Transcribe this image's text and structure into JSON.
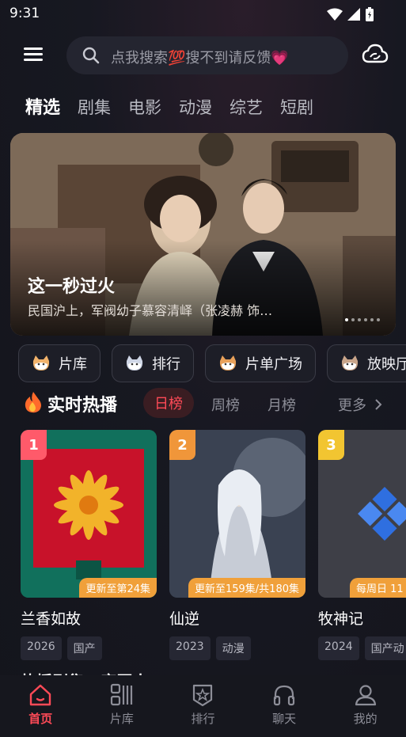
{
  "status_bar": {
    "time": "9:31"
  },
  "header": {
    "search_placeholder": "点我搜索💯搜不到请反馈💗"
  },
  "tabs": [
    "精选",
    "剧集",
    "电影",
    "动漫",
    "综艺",
    "短剧"
  ],
  "banner": {
    "title": "这一秒过火",
    "description": "民国沪上，军阀幼子慕容清峄（张凌赫 饰…"
  },
  "quick_buttons": [
    "片库",
    "排行",
    "片单广场",
    "放映厅"
  ],
  "hot": {
    "title": "实时热播",
    "rank_tabs": [
      "日榜",
      "周榜",
      "月榜"
    ],
    "more_label": "更多"
  },
  "cards": [
    {
      "rank": "1",
      "title": "兰香如故",
      "update": "更新至第24集",
      "tags": [
        "2026",
        "国产"
      ]
    },
    {
      "rank": "2",
      "title": "仙逆",
      "update": "更新至159集/共180集",
      "tags": [
        "2023",
        "动漫"
      ]
    },
    {
      "rank": "3",
      "title": "牧神记",
      "update": "每周日 11",
      "tags": [
        "2024",
        "国产动"
      ]
    }
  ],
  "peek_title": "热播剧集 · 宗国大",
  "bottom_nav": [
    "首页",
    "片库",
    "排行",
    "聊天",
    "我的"
  ],
  "colors": {
    "accent": "#ff4a57",
    "update_badge": "#f0a03a"
  }
}
